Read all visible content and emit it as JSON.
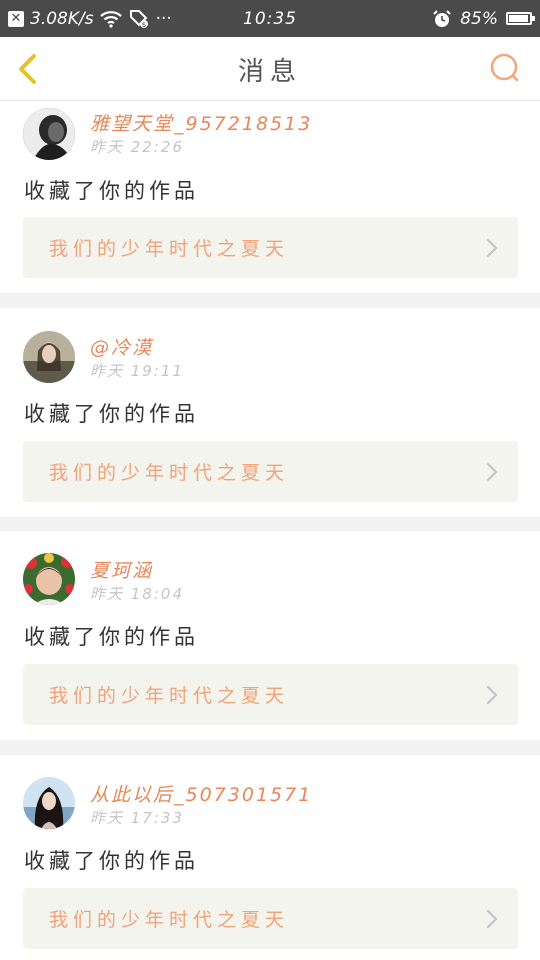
{
  "status_bar": {
    "speed": "3.08K/s",
    "more": "···",
    "time": "10:35",
    "battery": "85%",
    "battery_level": 0.85,
    "icons": [
      "close-notification-icon",
      "wifi-icon",
      "alarm-icon",
      "battery-icon"
    ]
  },
  "header": {
    "title": "消息",
    "back_icon": "chevron-left-icon",
    "search_icon": "search-icon",
    "accent_color": "#e8c02a"
  },
  "messages": [
    {
      "username": "雅望天堂_957218513",
      "time": "昨天 22:26",
      "action": "收藏了你的作品",
      "work_title": "我们的少年时代之夏天"
    },
    {
      "username": "@冷漠",
      "time": "昨天 19:11",
      "action": "收藏了你的作品",
      "work_title": "我们的少年时代之夏天"
    },
    {
      "username": "夏珂涵",
      "time": "昨天 18:04",
      "action": "收藏了你的作品",
      "work_title": "我们的少年时代之夏天"
    },
    {
      "username": "从此以后_507301571",
      "time": "昨天 17:33",
      "action": "收藏了你的作品",
      "work_title": "我们的少年时代之夏天"
    }
  ],
  "colors": {
    "username": "#e8875a",
    "work_title": "#f0a37a",
    "time": "#c5c5c5",
    "search_icon": "#f2a67c"
  }
}
